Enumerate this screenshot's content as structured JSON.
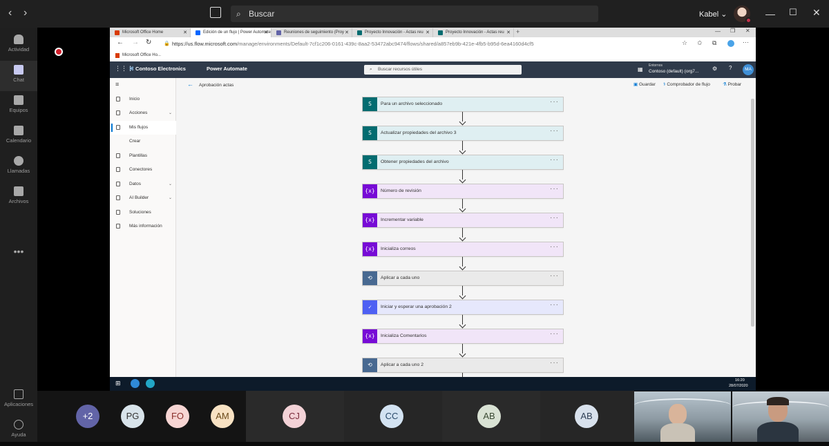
{
  "teams": {
    "search_placeholder": "Buscar",
    "user_name": "Kabel",
    "rail": [
      {
        "label": "Actividad",
        "icon": "bell-icon"
      },
      {
        "label": "Chat",
        "icon": "chat-icon"
      },
      {
        "label": "Equipos",
        "icon": "teams-icon"
      },
      {
        "label": "Calendario",
        "icon": "calendar-icon"
      },
      {
        "label": "Llamadas",
        "icon": "phone-icon"
      },
      {
        "label": "Archivos",
        "icon": "file-icon"
      }
    ],
    "rail_more": "•••",
    "rail_bottom": [
      {
        "label": "Aplicaciones",
        "icon": "apps-icon"
      },
      {
        "label": "Ayuda",
        "icon": "help-icon"
      }
    ]
  },
  "browser": {
    "tabs": [
      {
        "title": "Microsoft Office Home",
        "color": "#d83b01"
      },
      {
        "title": "Edición de un flujo | Power Automate",
        "color": "#0066ff"
      },
      {
        "title": "Reuniones de seguimiento (Proy",
        "color": "#6264a7"
      },
      {
        "title": "Proyecto Innovación - Actas reu",
        "color": "#036c70"
      },
      {
        "title": "Proyecto Innovación - Actas reu",
        "color": "#036c70"
      }
    ],
    "url_host": "https://us.flow.microsoft.com",
    "url_path": "/manage/environments/Default-7cf1c206-0161-439c-8aa2-53472abc9474/flows/shared/a857eb9b-421e-4fb5-b95d-6ea4160d4cf5",
    "favorite": "Microsoft Office Ho..."
  },
  "pa": {
    "org": "Contoso Electronics",
    "product": "Power Automate",
    "search_placeholder": "Buscar recursos útiles",
    "env_label": "Entornos",
    "env_name": "Contoso (default) (org7...",
    "avatar": "MA",
    "nav": [
      {
        "label": "Inicio",
        "chevron": false
      },
      {
        "label": "Acciones",
        "chevron": true
      },
      {
        "label": "Mis flujos",
        "chevron": false
      },
      {
        "label": "Crear",
        "chevron": false
      },
      {
        "label": "Plantillas",
        "chevron": false
      },
      {
        "label": "Conectores",
        "chevron": false
      },
      {
        "label": "Datos",
        "chevron": true
      },
      {
        "label": "AI Builder",
        "chevron": true
      },
      {
        "label": "Soluciones",
        "chevron": false
      },
      {
        "label": "Más información",
        "chevron": false
      }
    ],
    "flow_name": "Aprobación actas",
    "cmd": {
      "save": "Guardar",
      "checker": "Comprobador de flujo",
      "test": "Probar"
    },
    "steps": [
      {
        "label": "Para un archivo seleccionado",
        "kind": "sharepoint",
        "badge": "S",
        "bg": "#dfeff2",
        "accent": "#036c70"
      },
      {
        "label": "Actualizar propiedades del archivo 3",
        "kind": "sharepoint",
        "badge": "S",
        "bg": "#dfeff2",
        "accent": "#036c70"
      },
      {
        "label": "Obtener propiedades del archivo",
        "kind": "sharepoint",
        "badge": "S",
        "bg": "#dfeff2",
        "accent": "#036c70"
      },
      {
        "label": "Número de revisión",
        "kind": "variable",
        "badge": "{x}",
        "bg": "#f1e5f8",
        "accent": "#770bd6"
      },
      {
        "label": "Incrementar variable",
        "kind": "variable",
        "badge": "{x}",
        "bg": "#f1e5f8",
        "accent": "#770bd6"
      },
      {
        "label": "Inicializa correos",
        "kind": "variable",
        "badge": "{x}",
        "bg": "#f1e5f8",
        "accent": "#770bd6"
      },
      {
        "label": "Aplicar a cada uno",
        "kind": "loop",
        "badge": "⟲",
        "bg": "#eaeaea",
        "accent": "#486991"
      },
      {
        "label": "Iniciar y esperar una aprobación 2",
        "kind": "approval",
        "badge": "✓",
        "bg": "#e6e8fc",
        "accent": "#4e60f3"
      },
      {
        "label": "Inicializa Comentarios",
        "kind": "variable",
        "badge": "{x}",
        "bg": "#f1e5f8",
        "accent": "#770bd6"
      },
      {
        "label": "Aplicar a cada uno 2",
        "kind": "loop",
        "badge": "⟲",
        "bg": "#eaeaea",
        "accent": "#486991"
      }
    ],
    "step_menu": "···"
  },
  "taskbar": {
    "time": "16:20",
    "date": "28/07/2020"
  },
  "participants": [
    {
      "initials": "+2",
      "bg": "#6264a7",
      "fg": "#ffffff"
    },
    {
      "initials": "PG",
      "bg": "#d8e3ea",
      "fg": "#333333"
    },
    {
      "initials": "FO",
      "bg": "#f7d5d3",
      "fg": "#8a2e2a"
    },
    {
      "initials": "AM",
      "bg": "#f8e2c3",
      "fg": "#6b4a1a"
    },
    {
      "initials": "CJ",
      "bg": "#f3d2d7",
      "fg": "#7a2a3a"
    },
    {
      "initials": "CC",
      "bg": "#d3e3f2",
      "fg": "#2a4a6a"
    },
    {
      "initials": "AB",
      "bg": "#d9e2d4",
      "fg": "#3a4a33"
    },
    {
      "initials": "AB",
      "bg": "#d8e1ec",
      "fg": "#2f3f55"
    }
  ]
}
